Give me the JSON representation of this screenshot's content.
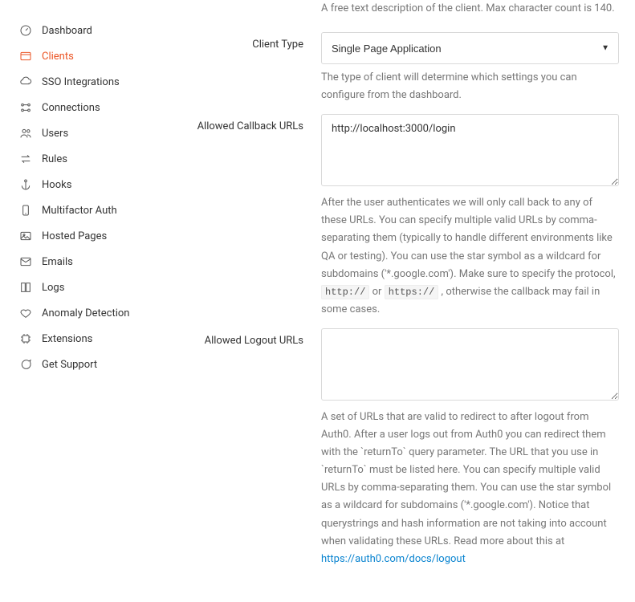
{
  "sidebar": {
    "items": [
      {
        "label": "Dashboard",
        "name": "sidebar-item-dashboard"
      },
      {
        "label": "Clients",
        "name": "sidebar-item-clients"
      },
      {
        "label": "SSO Integrations",
        "name": "sidebar-item-sso"
      },
      {
        "label": "Connections",
        "name": "sidebar-item-connections"
      },
      {
        "label": "Users",
        "name": "sidebar-item-users"
      },
      {
        "label": "Rules",
        "name": "sidebar-item-rules"
      },
      {
        "label": "Hooks",
        "name": "sidebar-item-hooks"
      },
      {
        "label": "Multifactor Auth",
        "name": "sidebar-item-mfa"
      },
      {
        "label": "Hosted Pages",
        "name": "sidebar-item-hosted-pages"
      },
      {
        "label": "Emails",
        "name": "sidebar-item-emails"
      },
      {
        "label": "Logs",
        "name": "sidebar-item-logs"
      },
      {
        "label": "Anomaly Detection",
        "name": "sidebar-item-anomaly"
      },
      {
        "label": "Extensions",
        "name": "sidebar-item-extensions"
      },
      {
        "label": "Get Support",
        "name": "sidebar-item-support"
      }
    ]
  },
  "form": {
    "description_helper": "A free text description of the client. Max character count is 140.",
    "client_type": {
      "label": "Client Type",
      "value": "Single Page Application",
      "helper": "The type of client will determine which settings you can configure from the dashboard."
    },
    "callback_urls": {
      "label": "Allowed Callback URLs",
      "value": "http://localhost:3000/login",
      "helper_pre": "After the user authenticates we will only call back to any of these URLs. You can specify multiple valid URLs by comma-separating them (typically to handle different environments like QA or testing). You can use the star symbol as a wildcard for subdomains ('*.google.com'). Make sure to specify the protocol, ",
      "helper_code1": "http://",
      "helper_mid": " or ",
      "helper_code2": "https://",
      "helper_post": " , otherwise the callback may fail in some cases."
    },
    "logout_urls": {
      "label": "Allowed Logout URLs",
      "value": "",
      "helper_pre": "A set of URLs that are valid to redirect to after logout from Auth0. After a user logs out from Auth0 you can redirect them with the `returnTo` query parameter. The URL that you use in `returnTo` must be listed here. You can specify multiple valid URLs by comma-separating them. You can use the star symbol as a wildcard for subdomains ('*.google.com'). Notice that querystrings and hash information are not taking into account when validating these URLs. Read more about this at ",
      "helper_link_text": "https://auth0.com/docs/logout"
    }
  }
}
